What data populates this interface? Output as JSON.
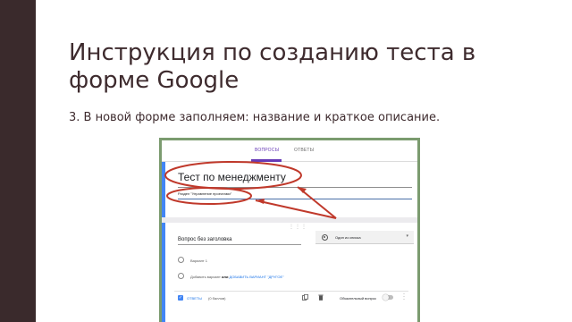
{
  "slide": {
    "title": "Инструкция по созданию теста в форме Google",
    "subtitle": "3. В новой форме заполняем: название и краткое описание."
  },
  "form": {
    "tabs": [
      {
        "label": "ВОПРОСЫ",
        "active": true
      },
      {
        "label": "ОТВЕТЫ",
        "active": false
      }
    ],
    "title": "Тест по менеджменту",
    "description": "Раздел \"Управление проектами\"",
    "question": {
      "title": "Вопрос без заголовка",
      "type_label": "Один из списка",
      "option1": "Вариант 1",
      "add_option": "Добавить вариант",
      "or": "или",
      "add_other": "ДОБАВИТЬ ВАРИАНТ \"ДРУГОЕ\"",
      "answers_label": "ОТВЕТЫ",
      "points_label": "(0 баллов)",
      "required_label": "Обязательный вопрос",
      "required": false
    }
  },
  "colors": {
    "slide_accent": "#3a2a2c",
    "form_accent": "#673ab7",
    "highlight_red": "#c0392b",
    "link_blue": "#1a73e8"
  }
}
